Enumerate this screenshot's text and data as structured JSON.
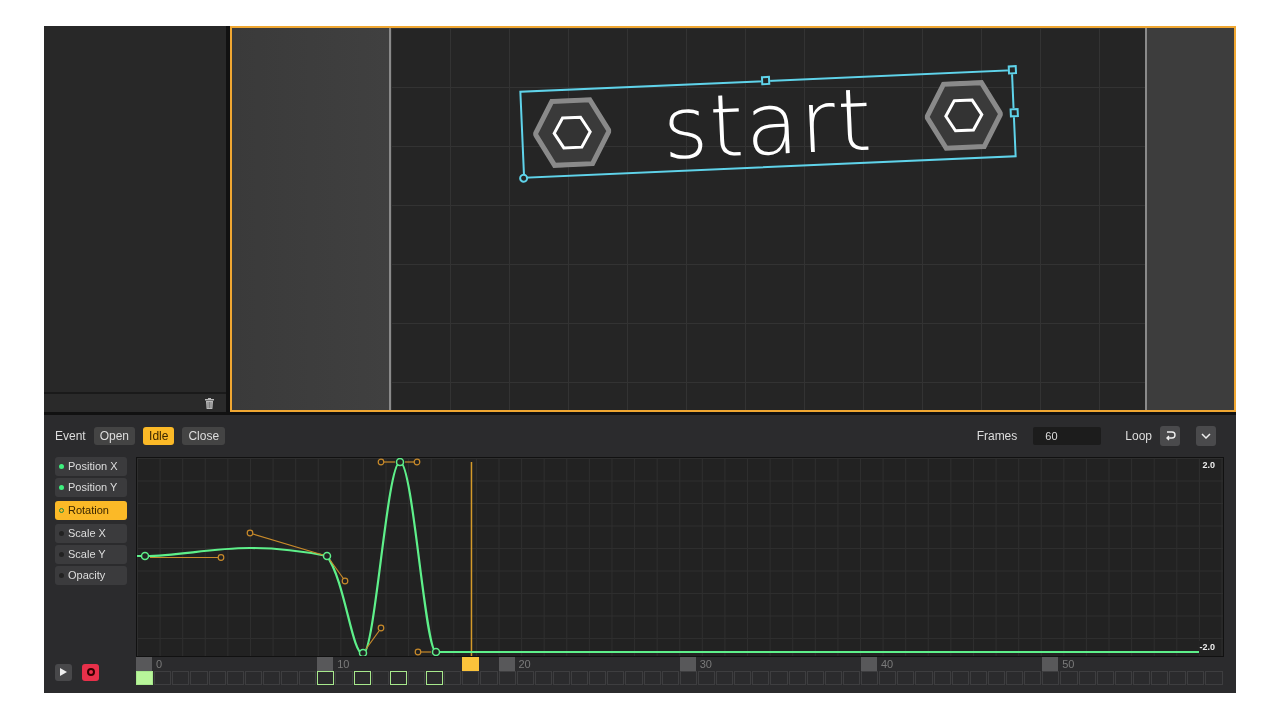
{
  "canvas": {
    "object": {
      "text": "start",
      "selected": true
    }
  },
  "event_bar": {
    "label": "Event",
    "events": [
      {
        "label": "Open",
        "selected": false
      },
      {
        "label": "Idle",
        "selected": true
      },
      {
        "label": "Close",
        "selected": false
      }
    ],
    "frames_label": "Frames",
    "frames_value": "60",
    "loop_label": "Loop"
  },
  "properties": [
    {
      "label": "Position X",
      "keyed": true,
      "selected": false
    },
    {
      "label": "Position Y",
      "keyed": true,
      "selected": false
    },
    {
      "label": "Rotation",
      "keyed": true,
      "selected": true
    },
    {
      "label": "Scale X",
      "keyed": false,
      "selected": false
    },
    {
      "label": "Scale Y",
      "keyed": false,
      "selected": false
    },
    {
      "label": "Opacity",
      "keyed": false,
      "selected": false
    }
  ],
  "graph": {
    "max_label": "2.0",
    "min_label": "-2.0"
  },
  "ruler": {
    "labels": [
      "0",
      "10",
      "20",
      "30",
      "40",
      "50"
    ]
  },
  "cells": [
    {
      "key": true,
      "selected": true,
      "current": false
    },
    {
      "key": false,
      "selected": false,
      "current": false
    },
    {
      "key": false,
      "selected": false,
      "current": false
    },
    {
      "key": false,
      "selected": false,
      "current": false
    },
    {
      "key": false,
      "selected": false,
      "current": false
    },
    {
      "key": false,
      "selected": false,
      "current": false
    },
    {
      "key": false,
      "selected": false,
      "current": false
    },
    {
      "key": false,
      "selected": false,
      "current": false
    },
    {
      "key": false,
      "selected": false,
      "current": false
    },
    {
      "key": false,
      "selected": false,
      "current": false
    },
    {
      "key": true,
      "selected": false,
      "current": false
    },
    {
      "key": false,
      "selected": false,
      "current": false
    },
    {
      "key": true,
      "selected": false,
      "current": false
    },
    {
      "key": false,
      "selected": false,
      "current": false
    },
    {
      "key": true,
      "selected": false,
      "current": false
    },
    {
      "key": false,
      "selected": false,
      "current": false
    },
    {
      "key": true,
      "selected": false,
      "current": false
    },
    {
      "key": false,
      "selected": false,
      "current": false
    },
    {
      "key": false,
      "selected": false,
      "current": true
    },
    {
      "key": false,
      "selected": false,
      "current": false
    },
    {
      "key": false,
      "selected": false,
      "current": false
    },
    {
      "key": false,
      "selected": false,
      "current": false
    },
    {
      "key": false,
      "selected": false,
      "current": false
    },
    {
      "key": false,
      "selected": false,
      "current": false
    },
    {
      "key": false,
      "selected": false,
      "current": false
    },
    {
      "key": false,
      "selected": false,
      "current": false
    },
    {
      "key": false,
      "selected": false,
      "current": false
    },
    {
      "key": false,
      "selected": false,
      "current": false
    },
    {
      "key": false,
      "selected": false,
      "current": false
    },
    {
      "key": false,
      "selected": false,
      "current": false
    },
    {
      "key": false,
      "selected": false,
      "current": false
    },
    {
      "key": false,
      "selected": false,
      "current": false
    },
    {
      "key": false,
      "selected": false,
      "current": false
    },
    {
      "key": false,
      "selected": false,
      "current": false
    },
    {
      "key": false,
      "selected": false,
      "current": false
    },
    {
      "key": false,
      "selected": false,
      "current": false
    },
    {
      "key": false,
      "selected": false,
      "current": false
    },
    {
      "key": false,
      "selected": false,
      "current": false
    },
    {
      "key": false,
      "selected": false,
      "current": false
    },
    {
      "key": false,
      "selected": false,
      "current": false
    },
    {
      "key": false,
      "selected": false,
      "current": false
    },
    {
      "key": false,
      "selected": false,
      "current": false
    },
    {
      "key": false,
      "selected": false,
      "current": false
    },
    {
      "key": false,
      "selected": false,
      "current": false
    },
    {
      "key": false,
      "selected": false,
      "current": false
    },
    {
      "key": false,
      "selected": false,
      "current": false
    },
    {
      "key": false,
      "selected": false,
      "current": false
    },
    {
      "key": false,
      "selected": false,
      "current": false
    },
    {
      "key": false,
      "selected": false,
      "current": false
    },
    {
      "key": false,
      "selected": false,
      "current": false
    },
    {
      "key": false,
      "selected": false,
      "current": false
    },
    {
      "key": false,
      "selected": false,
      "current": false
    },
    {
      "key": false,
      "selected": false,
      "current": false
    },
    {
      "key": false,
      "selected": false,
      "current": false
    },
    {
      "key": false,
      "selected": false,
      "current": false
    },
    {
      "key": false,
      "selected": false,
      "current": false
    },
    {
      "key": false,
      "selected": false,
      "current": false
    },
    {
      "key": false,
      "selected": false,
      "current": false
    },
    {
      "key": false,
      "selected": false,
      "current": false
    },
    {
      "key": false,
      "selected": false,
      "current": false
    }
  ]
}
